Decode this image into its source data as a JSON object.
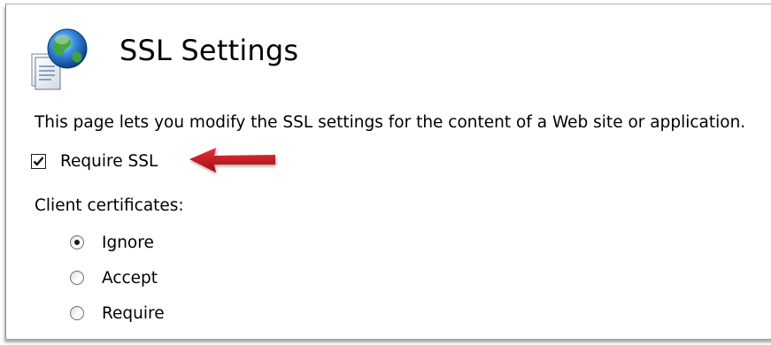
{
  "header": {
    "title": "SSL Settings"
  },
  "description": "This page lets you modify the SSL settings for the content of a Web site or application.",
  "require_ssl": {
    "label": "Require SSL",
    "checked": true
  },
  "client_certificates": {
    "label": "Client certificates:",
    "options": [
      {
        "label": "Ignore",
        "selected": true
      },
      {
        "label": "Accept",
        "selected": false
      },
      {
        "label": "Require",
        "selected": false
      }
    ]
  },
  "icons": {
    "page_icon": "globe-document-icon",
    "annotation": "red-arrow-icon"
  },
  "colors": {
    "arrow": "#c0141b",
    "globe_blue": "#2a6fc9",
    "globe_green": "#3ea33a"
  }
}
